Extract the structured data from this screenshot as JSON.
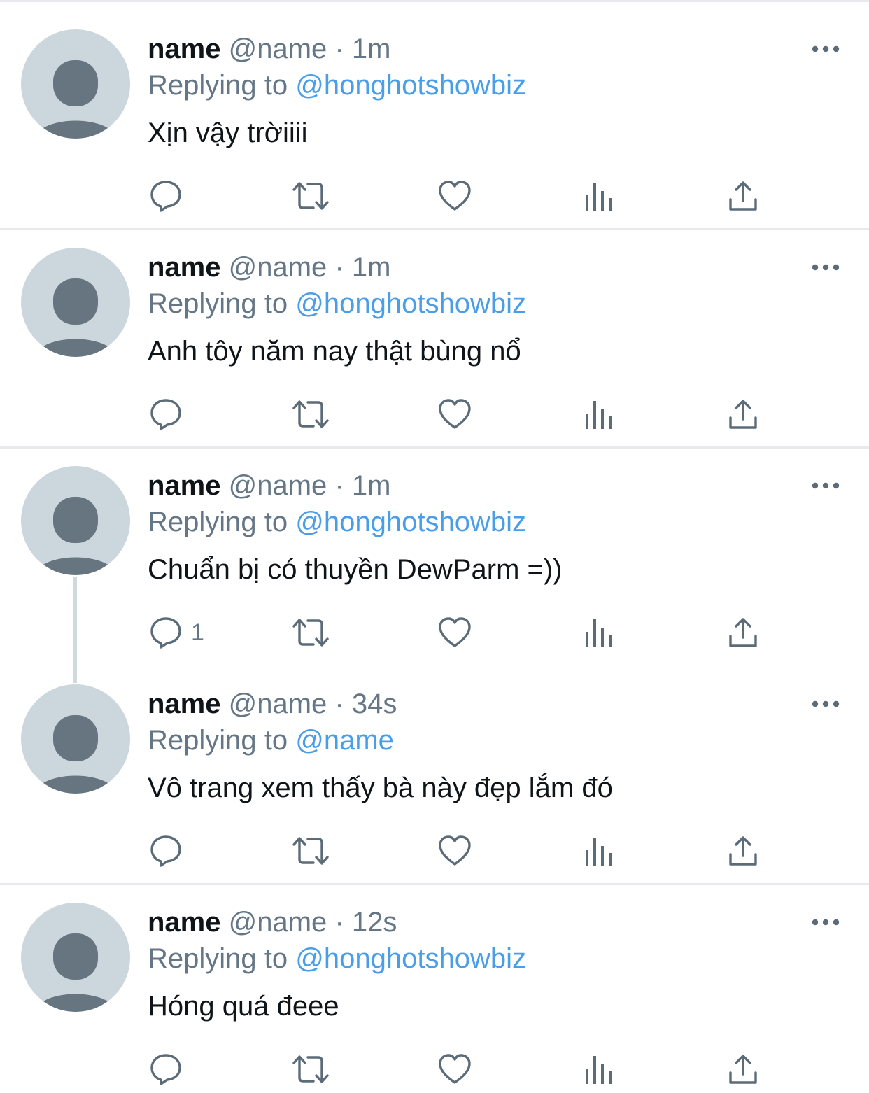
{
  "colors": {
    "text": "#0f1419",
    "muted": "#657786",
    "link": "#4a9ee8",
    "avatar_bg": "#ccd6dd",
    "avatar_fg": "#66757f",
    "divider": "#e7e9ec"
  },
  "tweets": [
    {
      "name": "name",
      "handle": "@name",
      "sep": "·",
      "time": "1m",
      "replying_prefix": "Replying to",
      "replying_to": "@honghotshowbiz",
      "text": "Xịn vậy trờiiii",
      "reply_count": ""
    },
    {
      "name": "name",
      "handle": "@name",
      "sep": "·",
      "time": "1m",
      "replying_prefix": "Replying to",
      "replying_to": "@honghotshowbiz",
      "text": "Anh tôy năm nay thật bùng nổ",
      "reply_count": ""
    },
    {
      "name": "name",
      "handle": "@name",
      "sep": "·",
      "time": "1m",
      "replying_prefix": "Replying to",
      "replying_to": "@honghotshowbiz",
      "text": "Chuẩn bị có thuyền DewParm =))",
      "reply_count": "1"
    },
    {
      "name": "name",
      "handle": "@name",
      "sep": "·",
      "time": "34s",
      "replying_prefix": "Replying to",
      "replying_to": "@name",
      "text": "Vô trang xem thấy bà này đẹp lắm đó",
      "reply_count": ""
    },
    {
      "name": "name",
      "handle": "@name",
      "sep": "·",
      "time": "12s",
      "replying_prefix": "Replying to",
      "replying_to": "@honghotshowbiz",
      "text": "Hóng quá đeee",
      "reply_count": ""
    }
  ],
  "icons": {
    "more": "more-horizontal-icon",
    "reply": "reply-bubble-icon",
    "retweet": "retweet-icon",
    "like": "heart-icon",
    "views": "views-bar-chart-icon",
    "share": "share-upload-icon"
  }
}
